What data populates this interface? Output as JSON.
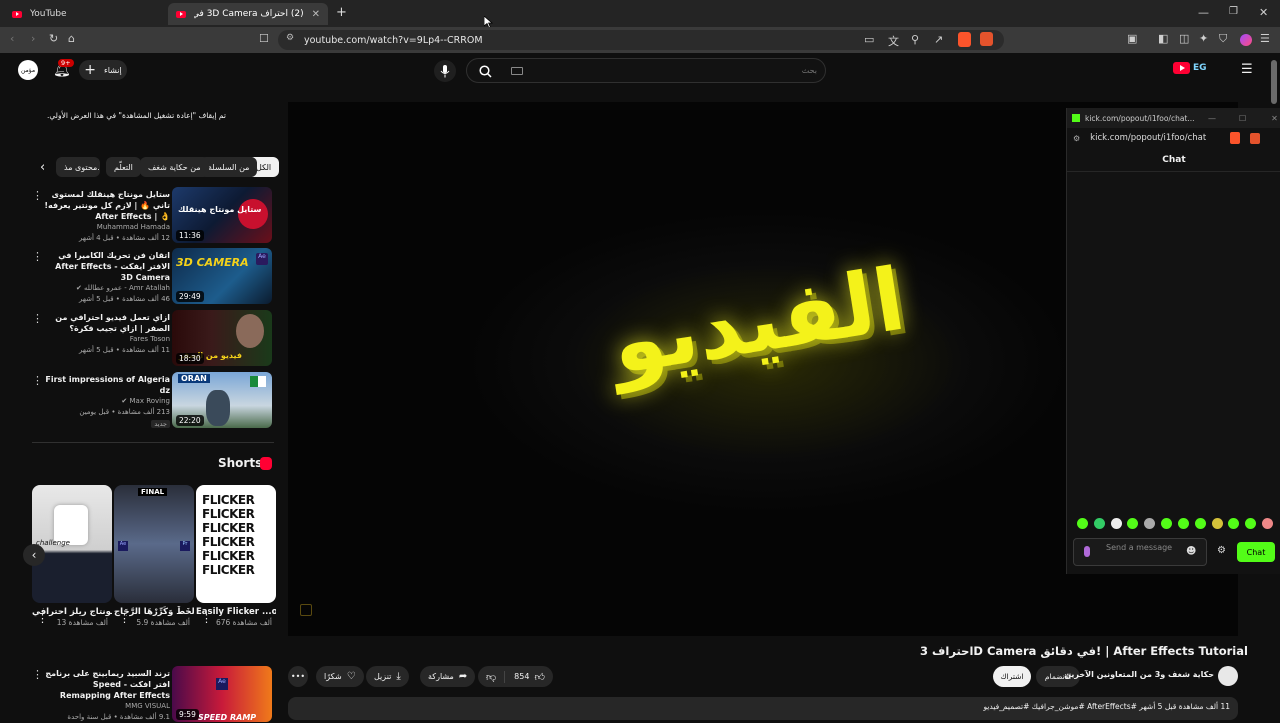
{
  "browser": {
    "tabs": [
      {
        "title": "YouTube",
        "active": false
      },
      {
        "title": "(2) احتراف 3D Camera في دقائق! |",
        "active": true
      }
    ],
    "new_tab_label": "+",
    "url": "youtube.com/watch?v=9Lp4--CRROM",
    "shield_badge": "1",
    "notif_badge": "1"
  },
  "youtube": {
    "avatar_text": "مؤمن",
    "notif_count": "9+",
    "create_label": "إنشاء",
    "search_placeholder": "بحث",
    "logo_suffix": "EG",
    "autoplay_notice": "تم إيقاف \"إعادة تشغيل المشاهدة\" في هذا العرض الأولي.",
    "chips": [
      {
        "label": "الكل",
        "selected": true
      },
      {
        "label": "من السلسلة",
        "selected": false
      },
      {
        "label": "من حكاية شغف",
        "selected": false
      },
      {
        "label": "التعلّم",
        "selected": false
      },
      {
        "label": "محتوى مذ...",
        "selected": false
      }
    ],
    "related": [
      {
        "title": "ستايل مونتاج هينقلك لمستوى تاني 🔥 | لازم كل مونتير يعرفه! 👌 | After Effects",
        "channel": "Muhammad Hamada",
        "meta": "12 ألف مشاهدة • قبل 4 أشهر",
        "duration": "11:36",
        "thumb_text": "ستايل مونتاج هينقلك"
      },
      {
        "title": "اتقان فن تحريك الكاميرا في الافتر ايفكت - After Effects 3D Camera",
        "channel": "Amr Atallah - عمرو عطالله ✔",
        "meta": "46 ألف مشاهدة • قبل 5 أشهر",
        "duration": "29:49",
        "thumb_text": "3D CAMERA"
      },
      {
        "title": "ازاي تعمل فيديو احترافي من الصفر | ازاي تجيب فكرة؟",
        "channel": "Fares Toson",
        "meta": "11 ألف مشاهدة • قبل 5 أشهر",
        "duration": "18:30",
        "thumb_text": "فيديو من الصفر"
      },
      {
        "title": "First impressions of Algeria dz",
        "channel": "Max Roving ✔",
        "meta": "213 ألف مشاهدة • قبل يومين",
        "badge": "جديد",
        "duration": "22:20",
        "thumb_text": "ORAN"
      }
    ],
    "shorts_title": "Shorts",
    "shorts": [
      {
        "title": "Easily Flicker ...our Text in",
        "views": "676 ألف مشاهدة",
        "thumb_text": "FLICKER"
      },
      {
        "title": "فَكَّهَا الخَطَّ وَكَرِّرْهَا الرَّجَاج ...",
        "views": "5.9 ألف مشاهدة",
        "thumb_text": "FINAL"
      },
      {
        "title": "مونتاج ريلز احترافي | ...",
        "views": "13 ألف مشاهدة",
        "thumb_text": "challenge"
      }
    ],
    "bottom_related": {
      "title": "ترند السبيد ريمابينج على برنامج افتر افكت - Speed Remapping After Effects",
      "channel": "MMG VISUAL",
      "meta": "9.1 ألف مشاهدة • قبل سنة واحدة",
      "duration": "9:59",
      "thumb_text": "SPEED RAMP"
    },
    "video": {
      "title": "احتراف 3D Camera في دقائق! | After Effects Tutorial",
      "center_text": "الفيديو",
      "channel": "حكاية شغف و3 من المتعاونين الآخرين",
      "join_label": "الانضمام",
      "subscribe_label": "اشتراك",
      "likes": "854",
      "share_label": "مشاركة",
      "download_label": "تنزيل",
      "thanks_label": "شكرًا",
      "more_label": "•••",
      "desc_meta": "11 ألف مشاهدة قبل 5 أشهر #AfterEffects #موشن_جرافيك #تصميم_فيديو"
    }
  },
  "kick": {
    "window_title": "kick.com/popout/i1foo/chat...",
    "url": "kick.com/popout/i1foo/chat",
    "header": "Chat",
    "message_placeholder": "Send a message",
    "chat_button": "Chat",
    "accent": "#53fc18"
  },
  "colors": {
    "bg": "#0f0f0f",
    "yt_red": "#ff0033",
    "kick_green": "#53fc18",
    "text_yellow": "#f4f21a"
  }
}
